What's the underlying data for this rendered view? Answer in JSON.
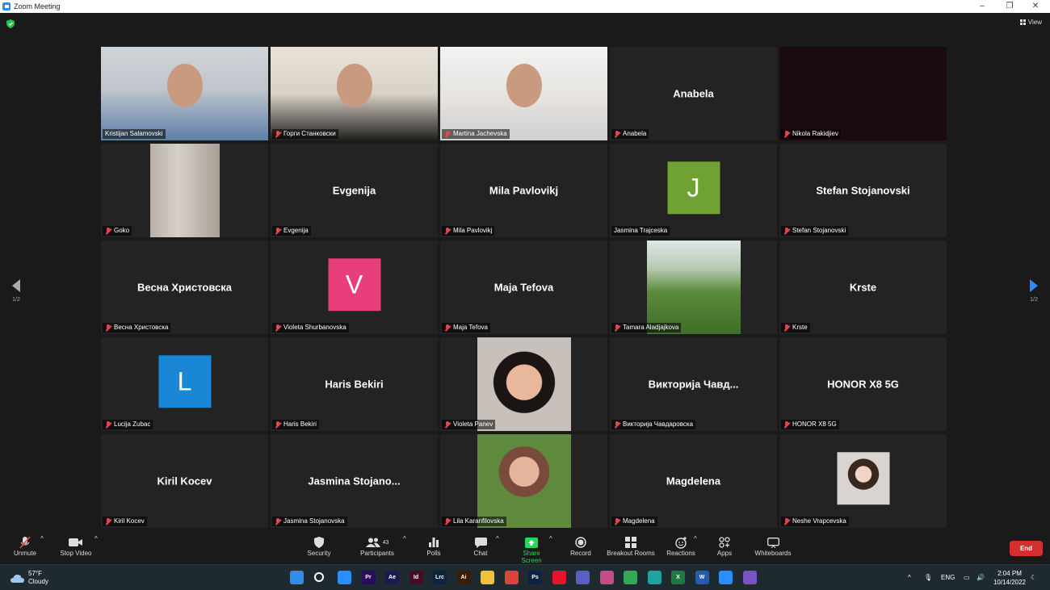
{
  "window": {
    "title": "Zoom Meeting",
    "controls": [
      "minimize-icon",
      "maximize-icon",
      "close-icon"
    ]
  },
  "view_label": "View",
  "pager": {
    "left": "1/2",
    "right": "1/2"
  },
  "tiles": [
    {
      "name": "Kristijan Salamovski",
      "display": "",
      "type": "video",
      "muted": false,
      "active": true
    },
    {
      "name": "Горги Станковски",
      "display": "",
      "type": "video",
      "muted": true
    },
    {
      "name": "Martina Jachevska",
      "display": "",
      "type": "video",
      "muted": true
    },
    {
      "name": "Anabela",
      "display": "Anabela",
      "type": "name",
      "muted": true
    },
    {
      "name": "Nikola Rakidjiev",
      "display": "",
      "type": "dark",
      "muted": true
    },
    {
      "name": "Goko",
      "display": "",
      "type": "blur",
      "muted": true
    },
    {
      "name": "Evgenija",
      "display": "Evgenija",
      "type": "name",
      "muted": true
    },
    {
      "name": "Mila Pavlovikj",
      "display": "Mila Pavlovikj",
      "type": "name",
      "muted": true
    },
    {
      "name": "Jasmina Trajceska",
      "display": "J",
      "type": "avatar",
      "color": "#6fa133",
      "muted": false
    },
    {
      "name": "Stefan Stojanovski",
      "display": "Stefan Stojanovski",
      "type": "name",
      "muted": true
    },
    {
      "name": "Весна Христовска",
      "display": "Весна Христовска",
      "type": "name",
      "muted": true
    },
    {
      "name": "Violeta Shurbanovska",
      "display": "V",
      "type": "avatar",
      "color": "#e83e7c",
      "muted": true
    },
    {
      "name": "Maja Tefova",
      "display": "Maja Tefova",
      "type": "name",
      "muted": true
    },
    {
      "name": "Tamara Aladjajkova",
      "display": "",
      "type": "photo-landscape",
      "muted": true
    },
    {
      "name": "Krste",
      "display": "Krste",
      "type": "name",
      "muted": true
    },
    {
      "name": "Lucija Zubac",
      "display": "L",
      "type": "avatar",
      "color": "#1a87d6",
      "muted": true
    },
    {
      "name": "Haris Bekiri",
      "display": "Haris Bekiri",
      "type": "name",
      "muted": true
    },
    {
      "name": "Violeta Panev",
      "display": "",
      "type": "photo-portrait",
      "muted": true
    },
    {
      "name": "Викторија Чавдаровска",
      "display": "Викторија Чавд...",
      "type": "name",
      "muted": true
    },
    {
      "name": "HONOR X8 5G",
      "display": "HONOR X8 5G",
      "type": "name",
      "muted": true
    },
    {
      "name": "Kiril Kocev",
      "display": "Kiril Kocev",
      "type": "name",
      "muted": true
    },
    {
      "name": "Jasmina Stojanovska",
      "display": "Jasmina  Stojano...",
      "type": "name",
      "muted": true
    },
    {
      "name": "Lila Karanfilovska",
      "display": "",
      "type": "photo-garden",
      "muted": true
    },
    {
      "name": "Magdelena",
      "display": "Magdelena",
      "type": "name",
      "muted": true
    },
    {
      "name": "Neshe Vrapcevska",
      "display": "",
      "type": "photo-small",
      "muted": true
    }
  ],
  "toolbar": {
    "unmute": "Unmute",
    "stop_video": "Stop Video",
    "security": "Security",
    "participants": "Participants",
    "participants_count": "43",
    "polls": "Polls",
    "chat": "Chat",
    "share_screen": "Share Screen",
    "record": "Record",
    "breakout": "Breakout Rooms",
    "reactions": "Reactions",
    "apps": "Apps",
    "whiteboards": "Whiteboards",
    "end": "End",
    "share_color": "#23d959",
    "end_color": "#d32f2f"
  },
  "taskbar": {
    "temp": "57°F",
    "condition": "Cloudy",
    "lang": "ENG",
    "time": "2:04 PM",
    "date": "10/14/2022",
    "apps": [
      {
        "icon": "windows-start-icon",
        "label": "",
        "color": "#2f8fe6"
      },
      {
        "icon": "search-icon",
        "label": "",
        "color": "transparent"
      },
      {
        "icon": "zoom-app-icon",
        "label": "",
        "color": "#2d8cff"
      },
      {
        "icon": "premiere-icon",
        "label": "Pr",
        "color": "#2a0b5c"
      },
      {
        "icon": "after-effects-icon",
        "label": "Ae",
        "color": "#1b1b4f"
      },
      {
        "icon": "indesign-icon",
        "label": "Id",
        "color": "#4a0c25"
      },
      {
        "icon": "lightroom-classic-icon",
        "label": "Lrc",
        "color": "#0a2440"
      },
      {
        "icon": "illustrator-icon",
        "label": "Ai",
        "color": "#3a1e02"
      },
      {
        "icon": "file-explorer-icon",
        "label": "",
        "color": "#f2c13b"
      },
      {
        "icon": "chrome-icon",
        "label": "",
        "color": "#db4437"
      },
      {
        "icon": "photoshop-icon",
        "label": "Ps",
        "color": "#0b2340"
      },
      {
        "icon": "opera-icon",
        "label": "",
        "color": "#e3142b"
      },
      {
        "icon": "teams-icon",
        "label": "",
        "color": "#5a5fc8"
      },
      {
        "icon": "photos-icon",
        "label": "",
        "color": "#c74b8a"
      },
      {
        "icon": "chrome-profile-icon",
        "label": "",
        "color": "#34a853"
      },
      {
        "icon": "edge-icon",
        "label": "",
        "color": "#1fa3a0"
      },
      {
        "icon": "excel-icon",
        "label": "X",
        "color": "#1d7a45"
      },
      {
        "icon": "word-icon",
        "label": "W",
        "color": "#245bb3"
      },
      {
        "icon": "zoom-app-icon",
        "label": "",
        "color": "#2d8cff"
      },
      {
        "icon": "viber-icon",
        "label": "",
        "color": "#7a52c7"
      }
    ]
  }
}
